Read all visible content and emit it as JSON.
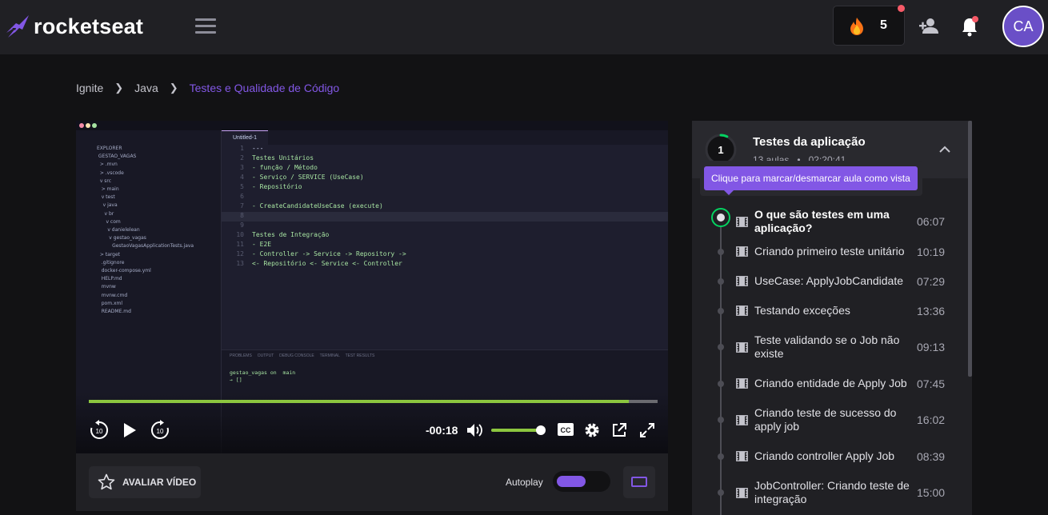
{
  "header": {
    "logo_text": "rocketseat",
    "streak_count": "5",
    "avatar_initials": "CA",
    "colors": {
      "brand": "#8257e5",
      "notification": "#f75a68",
      "success": "#04d361"
    }
  },
  "breadcrumb": [
    "Ignite",
    "Java",
    "Testes e Qualidade de Código"
  ],
  "video": {
    "time_remaining": "-00:18",
    "progress": 0.95,
    "volume": 1.0,
    "editor": {
      "tab": "Untitled-1",
      "lines": [
        {
          "n": "1",
          "text": "---"
        },
        {
          "n": "2",
          "text": "Testes Unitários"
        },
        {
          "n": "3",
          "text": "- função / Método"
        },
        {
          "n": "4",
          "text": "- Serviço / SERVICE (UseCase)"
        },
        {
          "n": "5",
          "text": "- Repositório"
        },
        {
          "n": "6",
          "text": ""
        },
        {
          "n": "7",
          "text": "- CreateCandidateUseCase (execute)"
        },
        {
          "n": "8",
          "text": ""
        },
        {
          "n": "9",
          "text": ""
        },
        {
          "n": "10",
          "text": "Testes de Integração"
        },
        {
          "n": "11",
          "text": "- E2E"
        },
        {
          "n": "12",
          "text": "- Controller -> Service -> Repository ->"
        },
        {
          "n": "13",
          "text": "<- Repositório <- Service <- Controller"
        }
      ],
      "tree": "EXPLORER\n GESTAO_VAGAS\n  > .mvn\n  > .vscode\n  v src\n   > main\n   v test\n    v java\n     v br\n      v com\n       v danielelean\n        v gestao_vagas\n          GestaoVagasApplicationTests.java\n  > target\n   .gitignore\n   docker-compose.yml\n   HELP.md\n   mvnw\n   mvnw.cmd\n   pom.xml\n   README.md",
      "panel_tabs": "PROBLEMS     OUTPUT     DEBUG CONSOLE     TERMINAL     TEST RESULTS",
      "terminal": "gestao_vagas on  main\n→ []"
    }
  },
  "below_video": {
    "rate_label": "AVALIAR VÍDEO",
    "autoplay_label": "Autoplay",
    "autoplay_on": true
  },
  "module": {
    "number": "1",
    "title": "Testes da aplicação",
    "lessons_count": "13 aulas",
    "total_duration": "02:20:41",
    "tooltip": "Clique para marcar/desmarcar aula como vista",
    "lessons": [
      {
        "title": "O que são testes em uma aplicação?",
        "duration": "06:07",
        "current": true
      },
      {
        "title": "Criando primeiro teste unitário",
        "duration": "10:19"
      },
      {
        "title": "UseCase: ApplyJobCandidate",
        "duration": "07:29"
      },
      {
        "title": "Testando exceções",
        "duration": "13:36"
      },
      {
        "title": "Teste validando se o Job não existe",
        "duration": "09:13"
      },
      {
        "title": "Criando entidade de Apply Job",
        "duration": "07:45"
      },
      {
        "title": "Criando teste de sucesso do apply job",
        "duration": "16:02"
      },
      {
        "title": "Criando controller Apply Job",
        "duration": "08:39"
      },
      {
        "title": "JobController: Criando teste de integração",
        "duration": "15:00"
      }
    ]
  }
}
